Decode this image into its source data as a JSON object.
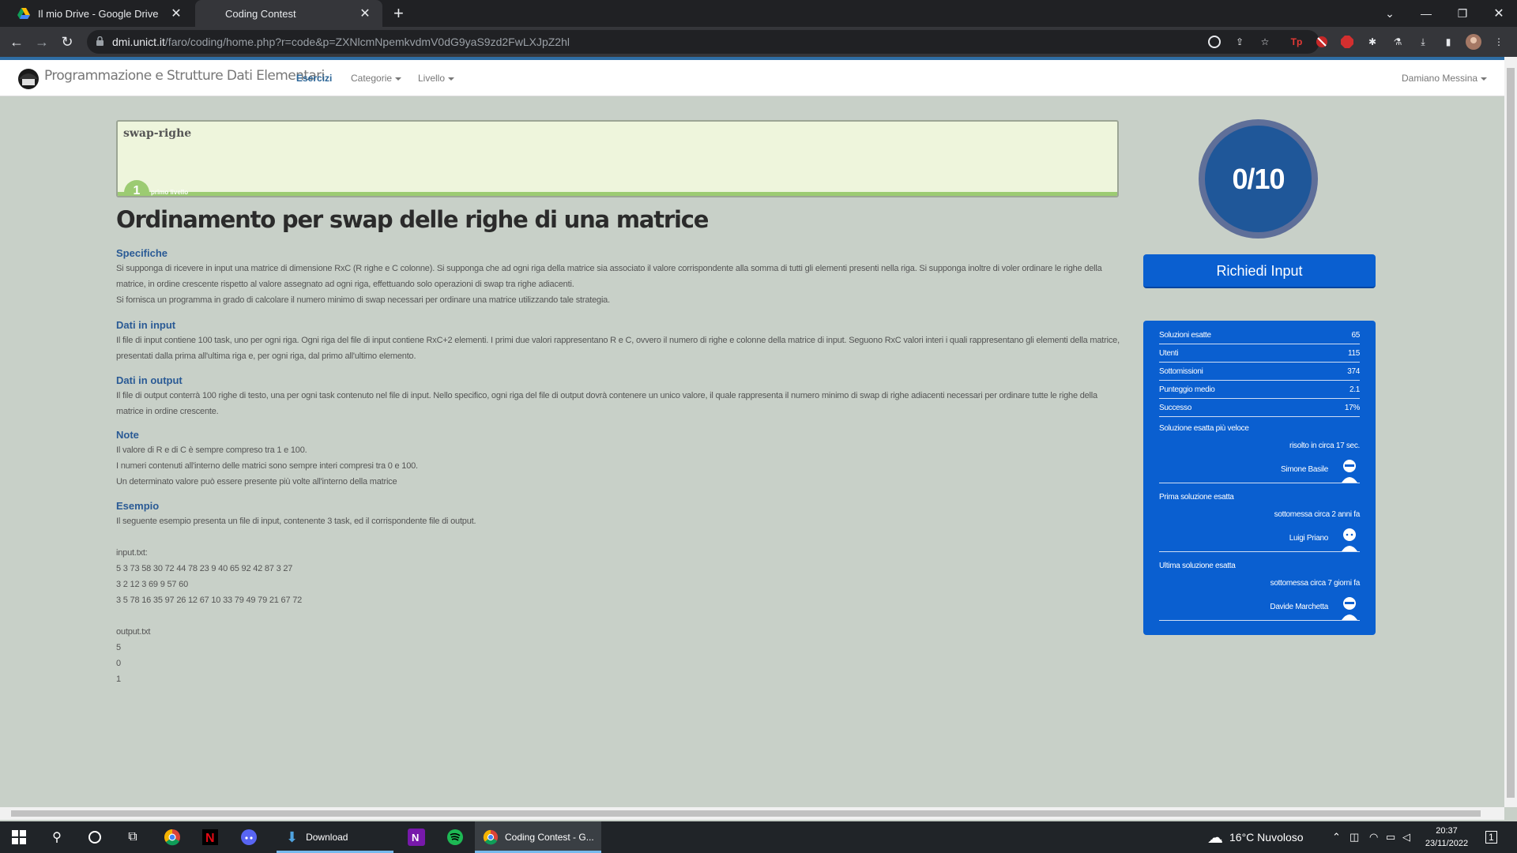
{
  "browser": {
    "tabs": [
      {
        "title": "Il mio Drive - Google Drive"
      },
      {
        "title": "Coding Contest"
      }
    ],
    "url_host": "dmi.unict.it",
    "url_path": "/faro/coding/home.php?r=code&p=ZXNlcmNpemkvdmV0dG9yaS9zd2FwLXJpZ2hl"
  },
  "site": {
    "brand": "Programmazione e Strutture Dati Elementari",
    "nav": {
      "esercizi": "Esercizi",
      "categorie": "Categorie",
      "livello": "Livello"
    },
    "user": "Damiano Messina"
  },
  "task": {
    "slug": "swap-righe",
    "level_number": "1",
    "level_text": "primo livello",
    "title": "Ordinamento per swap delle righe di una matrice"
  },
  "sections": {
    "specifiche": {
      "heading": "Specifiche",
      "lines": [
        "Si supponga di ricevere in input una matrice di dimensione RxC (R righe e C colonne). Si supponga che ad ogni riga della matrice sia associato il valore corrispondente alla somma di tutti gli elementi presenti nella riga. Si supponga inoltre di voler ordinare le righe della matrice, in ordine crescente rispetto al valore assegnato ad ogni riga, effettuando solo operazioni di swap tra righe adiacenti.",
        "Si fornisca un programma in grado di calcolare il numero minimo di swap necessari per ordinare una matrice utilizzando tale strategia."
      ]
    },
    "input": {
      "heading": "Dati in input",
      "lines": [
        "Il file di input contiene 100 task, uno per ogni riga. Ogni riga del file di input contiene RxC+2 elementi. I primi due valori rappresentano R e C, ovvero il numero di righe e colonne della matrice di input. Seguono RxC valori interi i quali rappresentano gli elementi della matrice, presentati dalla prima all'ultima riga e, per ogni riga, dal primo all'ultimo elemento."
      ]
    },
    "output": {
      "heading": "Dati in output",
      "lines": [
        "Il file di output conterrà 100 righe di testo, una per ogni task contenuto nel file di input. Nello specifico, ogni riga del file di output dovrà contenere un unico valore, il quale rappresenta il numero minimo di swap di righe adiacenti necessari per ordinare tutte le righe della matrice in ordine crescente."
      ]
    },
    "note": {
      "heading": "Note",
      "lines": [
        "Il valore di R e di C è sempre compreso tra 1 e 100.",
        "I numeri contenuti all'interno delle matrici sono sempre interi compresi tra 0 e 100.",
        "Un determinato valore può essere presente più volte all'interno della matrice"
      ]
    },
    "esempio": {
      "heading": "Esempio",
      "intro": "Il seguente esempio presenta un file di input, contenente 3 task, ed il corrispondente file di output.",
      "input_label": "input.txt:",
      "input_lines": [
        "5 3 73 58 30 72 44 78 23 9 40 65 92 42 87 3 27",
        "3 2 12 3 69 9 57 60",
        "3 5 78 16 35 97 26 12 67 10 33 79 49 79 21 67 72"
      ],
      "output_label": "output.txt",
      "output_lines": [
        "5",
        "0",
        "1"
      ]
    }
  },
  "score": "0/10",
  "request_button": "Richiedi Input",
  "stats": {
    "rows": [
      {
        "label": "Soluzioni esatte",
        "value": "65"
      },
      {
        "label": "Utenti",
        "value": "115"
      },
      {
        "label": "Sottomissioni",
        "value": "374"
      },
      {
        "label": "Punteggio medio",
        "value": "2.1"
      },
      {
        "label": "Successo",
        "value": "17%"
      }
    ],
    "fastest": {
      "label": "Soluzione esatta più veloce",
      "detail": "risolto in circa 17 sec.",
      "user": "Simone Basile"
    },
    "first": {
      "label": "Prima soluzione esatta",
      "detail": "sottomessa circa 2 anni fa",
      "user": "Luigi Priano"
    },
    "last": {
      "label": "Ultima soluzione esatta",
      "detail": "sottomessa circa 7 giorni fa",
      "user": "Davide Marchetta"
    }
  },
  "taskbar": {
    "download_label": "Download",
    "chrome_label": "Coding Contest - G...",
    "weather": "16°C  Nuvoloso",
    "time": "20:37",
    "date": "23/11/2022",
    "notifications": "1"
  },
  "colors": {
    "page_bg": "#c8d0c8",
    "accent_blue": "#0a5fd0",
    "heading_blue": "#2a5a95",
    "level_green": "#9ccb72"
  }
}
